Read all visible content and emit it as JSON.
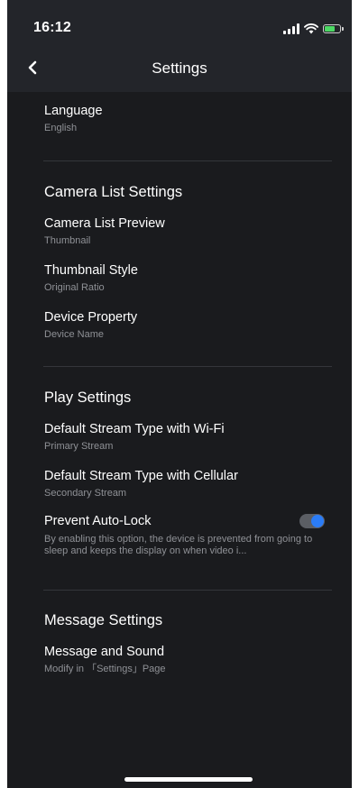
{
  "status_bar": {
    "time": "16:12",
    "icons": [
      "signal-icon",
      "wifi-icon",
      "battery-charging-icon"
    ]
  },
  "nav": {
    "title": "Settings",
    "back_icon": "chevron-left-icon"
  },
  "language": {
    "title": "Language",
    "value": "English"
  },
  "camera_list_settings": {
    "header": "Camera List Settings",
    "items": [
      {
        "title": "Camera List Preview",
        "value": "Thumbnail"
      },
      {
        "title": "Thumbnail Style",
        "value": "Original Ratio"
      },
      {
        "title": "Device Property",
        "value": "Device Name"
      }
    ]
  },
  "play_settings": {
    "header": "Play Settings",
    "items": [
      {
        "title": "Default Stream Type with Wi-Fi",
        "value": "Primary Stream"
      },
      {
        "title": "Default Stream Type with Cellular",
        "value": "Secondary Stream"
      }
    ],
    "auto_lock": {
      "title": "Prevent Auto-Lock",
      "description": "By enabling this option, the device is prevented from going to sleep and keeps the display on when video i...",
      "enabled": true
    }
  },
  "message_settings": {
    "header": "Message Settings",
    "items": [
      {
        "title": "Message and Sound",
        "value": "Modify in 「Settings」Page"
      }
    ]
  },
  "colors": {
    "background": "#1a1b1e",
    "header_background": "#23252a",
    "primary_text": "#ffffff",
    "secondary_text": "#8f9196",
    "accent": "#2b7cf6"
  }
}
